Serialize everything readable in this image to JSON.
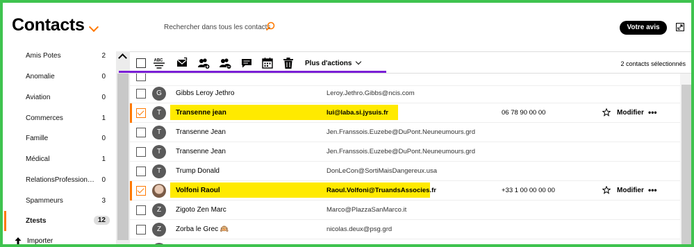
{
  "header": {
    "title": "Contacts",
    "search_placeholder": "Rechercher dans tous les contacts",
    "feedback_label": "Votre avis"
  },
  "sidebar": {
    "items": [
      {
        "label": "Amis Potes",
        "count": "2"
      },
      {
        "label": "Anomalie",
        "count": "0"
      },
      {
        "label": "Aviation",
        "count": "0"
      },
      {
        "label": "Commerces",
        "count": "1"
      },
      {
        "label": "Famille",
        "count": "0"
      },
      {
        "label": "Médical",
        "count": "1"
      },
      {
        "label": "RelationsProfession…",
        "count": "0"
      },
      {
        "label": "Spammeurs",
        "count": "3"
      },
      {
        "label": "Ztests",
        "count": "12",
        "active": true
      }
    ],
    "import_label": "Importer"
  },
  "toolbar": {
    "more_actions_label": "Plus d'actions",
    "selected_label": "2 contacts sélectionnés",
    "icons": [
      "sort-abc-icon",
      "mail-icon",
      "group-add-icon",
      "group-remove-icon",
      "sms-icon",
      "calendar-icon",
      "trash-icon"
    ]
  },
  "contacts": [
    {
      "initial": "",
      "name": "Gibbs Leroy Jethro",
      "email": "Leroy.Jethro.Gibbs@ncis.com",
      "phone": "",
      "selected": false
    },
    {
      "initial": "T",
      "name": "Transenne jean",
      "email": "lui@laba.si.jysuis.fr",
      "phone": "06 78 90 00 00",
      "selected": true
    },
    {
      "initial": "T",
      "name": "Transenne Jean",
      "email": "Jen.Franssois.Euzebe@DuPont.Neuneumours.grd",
      "phone": "",
      "selected": false
    },
    {
      "initial": "T",
      "name": "Transenne Jean",
      "email": "Jen.Franssois.Euzebe@DuPont.Neuneumours.grd",
      "phone": "",
      "selected": false
    },
    {
      "initial": "T",
      "name": "Trump Donald",
      "email": "DonLeCon@SortiMaisDangereux.usa",
      "phone": "",
      "selected": false
    },
    {
      "initial": "",
      "name": "Volfoni Raoul",
      "email": "Raoul.Volfoni@TruandsAssocies.fr",
      "phone": "+33 1 00 00 00 00",
      "selected": true
    },
    {
      "initial": "Z",
      "name": "Zigoto Zen Marc",
      "email": "Marco@PlazzaSanMarco.it",
      "phone": "",
      "selected": false
    },
    {
      "initial": "Z",
      "name": "Zorba le Grec 🙉",
      "email": "nicolas.deux@psg.grd",
      "phone": "",
      "selected": false
    }
  ],
  "row_actions": {
    "edit_label": "Modifier",
    "more_label": "•••"
  },
  "first_initial": "G",
  "colors": {
    "accent": "#ff7900",
    "highlight": "#ffea00",
    "border": "#3fc34f",
    "underline": "#7a1fd6"
  }
}
